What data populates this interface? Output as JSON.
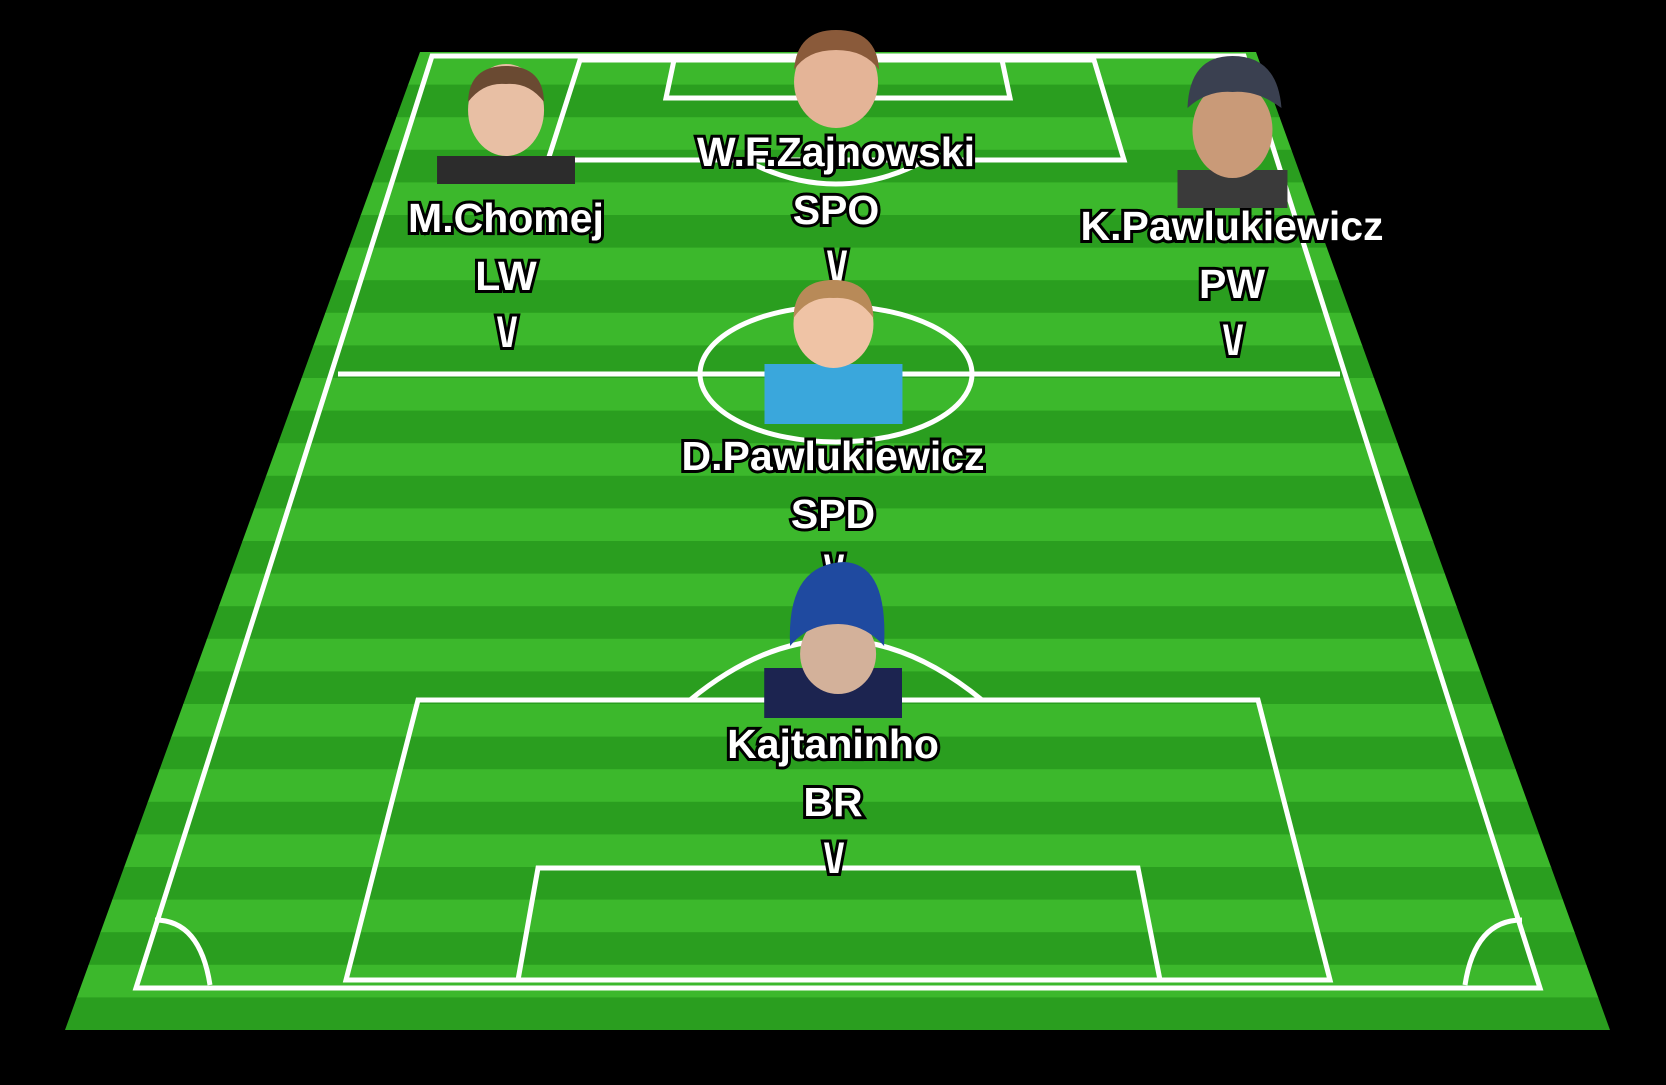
{
  "pitch": {
    "grass_light": "#3cb82c",
    "grass_dark": "#2a9e1f",
    "line_color": "#ffffff",
    "background": "#000000"
  },
  "players": [
    {
      "id": "spo",
      "name": "W.F.Zajnowski",
      "position": "SPO",
      "marker": "\\/",
      "avatar": "player-photo-hair-brown",
      "shirt_color": "#c89a7a",
      "hair_color": "#8a5a3a"
    },
    {
      "id": "lw",
      "name": "M.Chomej",
      "position": "LW",
      "marker": "\\/",
      "avatar": "player-photo-dark-shirt",
      "shirt_color": "#2c2c2c",
      "hair_color": "#6a4a32"
    },
    {
      "id": "pw",
      "name": "K.Pawlukiewicz",
      "position": "PW",
      "marker": "\\/",
      "avatar": "player-photo-cap",
      "shirt_color": "#3a3a3a",
      "hair_color": "#3a4050"
    },
    {
      "id": "spd",
      "name": "D.Pawlukiewicz",
      "position": "SPD",
      "marker": "\\/",
      "avatar": "player-photo-blue-hoodie",
      "shirt_color": "#3aa7dc",
      "hair_color": "#b88a58"
    },
    {
      "id": "br",
      "name": "Kajtaninho",
      "position": "BR",
      "marker": "\\/",
      "avatar": "player-photo-beanie",
      "shirt_color": "#1c2450",
      "hair_color": "#1f4aa0"
    }
  ]
}
